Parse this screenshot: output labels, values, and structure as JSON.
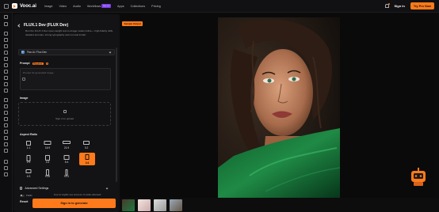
{
  "app": {
    "name": "Vooc.ai",
    "nav": [
      {
        "label": "Image"
      },
      {
        "label": "Video"
      },
      {
        "label": "Audio"
      },
      {
        "label": "Workflows",
        "badge": "NEW"
      },
      {
        "label": "Apps"
      },
      {
        "label": "Collections"
      },
      {
        "label": "Pricing"
      }
    ],
    "signin_label": "Sign in",
    "trypro_label": "Try Pro Now"
  },
  "panel": {
    "model_title": "FLUX.1 Dev (FLUX Dev)",
    "model_description": "Run the FLUX.1 Dev open-weight text-to-image model online— high-fidelity stills, detailed prompts, strong typography and no local install.",
    "model_select": "Flux AI / Flux Dev",
    "prompt_label": "Prompt",
    "required_badge": "Required",
    "prompt_placeholder": "Prompt for generated image",
    "image_label": "Image",
    "upload_text": "Sign in to upload",
    "aspect_label": "Aspect Ratio",
    "ratios": [
      "1:1",
      "16:9",
      "21:9",
      "3:2",
      "2:3",
      "4:5",
      "5:4",
      "3:4",
      "4:3",
      "9:16",
      "9:21"
    ],
    "active_ratio": "3:4",
    "advanced_label": "Advanced Settings",
    "public_label": "Public",
    "public_note": "Free for eligible new accounts. 8 credits afterward",
    "reset_label": "Reset",
    "generate_label": "Sign in to generate"
  },
  "viewer": {
    "sample_tag": "Sample Output"
  },
  "colors": {
    "accent": "#ff7a1a",
    "background": "#0b0b0c",
    "panel": "#131315"
  }
}
